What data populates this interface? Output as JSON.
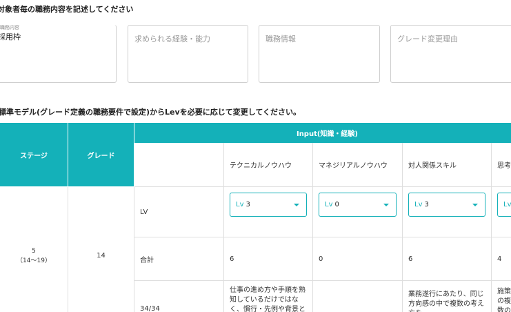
{
  "section1": {
    "title": "対象者毎の職務内容を記述してください"
  },
  "fields": [
    {
      "label": "職務内容",
      "value": "採用枠",
      "placeholder": ""
    },
    {
      "label": "",
      "value": "",
      "placeholder": "求められる経験・能力"
    },
    {
      "label": "",
      "value": "",
      "placeholder": "職務情報"
    },
    {
      "label": "",
      "value": "",
      "placeholder": "グレード変更理由"
    }
  ],
  "section2": {
    "title": "標準モデル(グレード定義の職務要件で設定)からLevを必要に応じて変更してください。"
  },
  "table": {
    "header": {
      "stage": "ステージ",
      "grade": "グレード",
      "input_group": "Input(知識・経験)",
      "columns": [
        "テクニカルノウハウ",
        "マネジリアルノウハウ",
        "対人関係スキル",
        "思考技"
      ]
    },
    "row": {
      "stage_value": "5",
      "stage_range": "（14〜19）",
      "grade_value": "14",
      "lv_label": "LV",
      "lv_prefix": "Lv",
      "lv_values": [
        "3",
        "0",
        "3"
      ],
      "total_label": "合計",
      "totals": [
        "6",
        "0",
        "6",
        "4"
      ],
      "score_label": "34/34",
      "descriptions": [
        "仕事の進め方や手順を熟知しているだけではなく、慣行・先例や背景となる原",
        "",
        "業務遂行にあたり、同じ方向感の中で複数の考え方を",
        "施策の複数の"
      ]
    }
  },
  "colors": {
    "accent": "#14b1b9",
    "border": "#dedede"
  },
  "icons": {
    "dropdown": "caret-down-icon"
  }
}
